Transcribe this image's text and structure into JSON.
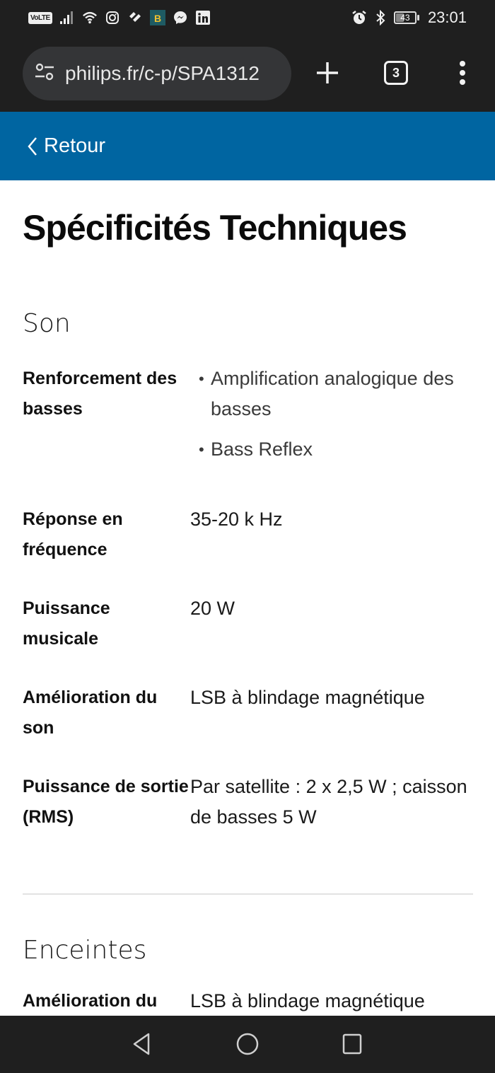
{
  "status_bar": {
    "left_icons": [
      "volte-icon",
      "signal-icon",
      "wifi-icon",
      "instagram-icon",
      "health-app-icon",
      "game-app-icon",
      "messenger-icon",
      "linkedin-icon"
    ],
    "volte_label": "VoLTE",
    "battery_level": "43",
    "battery_fraction": 0.43,
    "time": "23:01"
  },
  "browser": {
    "url": "philips.fr/c-p/SPA1312",
    "tab_count": "3"
  },
  "page": {
    "back_label": "Retour",
    "title": "Spécificités Techniques",
    "sections": [
      {
        "title": "Son",
        "rows": [
          {
            "label": "Renforcement des basses",
            "bullets": [
              "Amplification analogique des basses",
              "Bass Reflex"
            ]
          },
          {
            "label": "Réponse en fréquence",
            "value": "35-20 k  Hz"
          },
          {
            "label": "Puissance musicale",
            "value": "20  W"
          },
          {
            "label": "Amélioration du son",
            "value": "LSB à blindage magnétique"
          },
          {
            "label": "Puissance de sortie (RMS)",
            "value": "Par satellite : 2 x 2,5 W ; caisson de basses 5 W"
          }
        ]
      },
      {
        "title": "Enceintes",
        "rows": [
          {
            "label": "Amélioration du son",
            "value": "LSB à blindage magnétique"
          }
        ]
      }
    ]
  },
  "colors": {
    "header_blue": "#0065a1",
    "system_bar": "#1f1f1f",
    "url_pill": "#343537"
  }
}
